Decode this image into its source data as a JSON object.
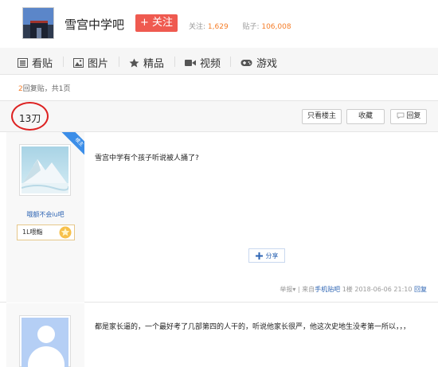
{
  "header": {
    "forum_name": "雪宫中学吧",
    "follow_label": "+ 关注",
    "followers_label": "关注:",
    "followers_value": "1,629",
    "posts_label": "贴子:",
    "posts_value": "106,008"
  },
  "nav": {
    "items": [
      {
        "label": "看贴",
        "icon": "list-icon"
      },
      {
        "label": "图片",
        "icon": "picture-icon"
      },
      {
        "label": "精品",
        "icon": "star-icon"
      },
      {
        "label": "视频",
        "icon": "video-icon"
      },
      {
        "label": "游戏",
        "icon": "gamepad-icon"
      }
    ]
  },
  "reply_info": {
    "count": "2",
    "text": "回复贴，共1页"
  },
  "thread": {
    "title": "13刀",
    "only_op_label": "只看楼主",
    "favorite_label": "收藏",
    "reply_label": "回复"
  },
  "post1": {
    "op_badge": "楼主",
    "username": "哦额不会iu吧",
    "level_text": "1L喂鮨",
    "content": "雪宫中学有个孩子听说被人捅了?",
    "share_label": "分享",
    "report_label": "举报",
    "source_prefix": "来自",
    "source_link": "手机贴吧",
    "floor": "1楼",
    "timestamp": "2018-06-06 21:10",
    "reply_link": "回复"
  },
  "post2": {
    "content": "都是家长逼的，一个最好考了几部第四的人干的，听说他家长很严，他这次史地生没考第一所以，，，"
  },
  "colors": {
    "follow_button": "#ef5a50",
    "accent_orange": "#f57d28",
    "link_blue": "#2d64b3",
    "annotation_red": "#dd2222"
  }
}
